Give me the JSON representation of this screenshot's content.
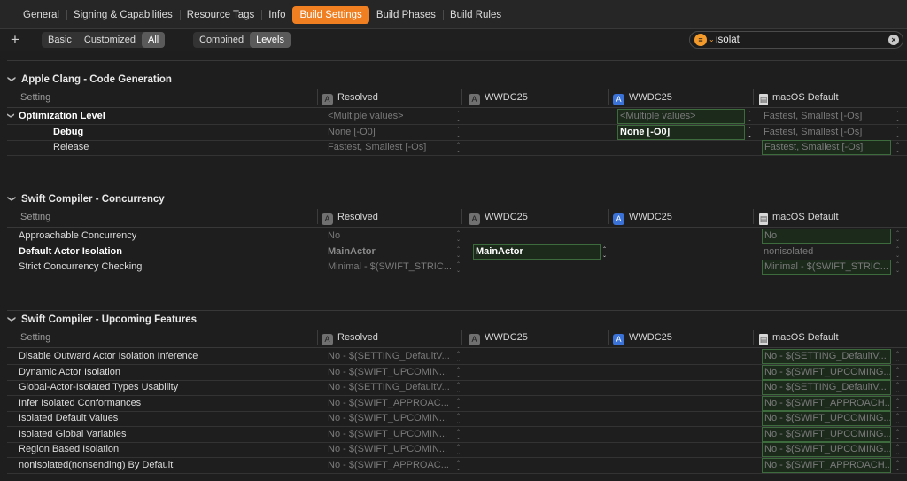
{
  "tabs": [
    {
      "label": "General",
      "active": false
    },
    {
      "label": "Signing & Capabilities",
      "active": false
    },
    {
      "label": "Resource Tags",
      "active": false
    },
    {
      "label": "Info",
      "active": false
    },
    {
      "label": "Build Settings",
      "active": true
    },
    {
      "label": "Build Phases",
      "active": false
    },
    {
      "label": "Build Rules",
      "active": false
    }
  ],
  "toolbar": {
    "add": "+",
    "scope": [
      "Basic",
      "Customized",
      "All"
    ],
    "scope_selected": "All",
    "view": [
      "Combined",
      "Levels"
    ],
    "view_selected": "Levels",
    "search_value": "isolat",
    "filter_icon": "line-3-horizontal-decrease-circle-icon",
    "clear_icon": "xmark-circle-icon"
  },
  "columns": {
    "setting": "Setting",
    "resolved": "Resolved",
    "target": "WWDC25",
    "project": "WWDC25",
    "default": "macOS Default"
  },
  "sections": [
    {
      "title": "Apple Clang - Code Generation",
      "rows": [
        {
          "name": "Optimization Level",
          "bold": true,
          "indent": false,
          "resolved": "<Multiple values>",
          "target": "",
          "project": "<Multiple values>",
          "project_hi": true,
          "project_bold": false,
          "default": "Fastest, Smallest [-Os]",
          "default_hi": false
        },
        {
          "name": "Debug",
          "bold": true,
          "indent": true,
          "resolved": "None [-O0]",
          "target": "",
          "project": "None [-O0]",
          "project_hi": true,
          "project_bold": true,
          "default": "Fastest, Smallest [-Os]",
          "default_hi": false
        },
        {
          "name": "Release",
          "bold": false,
          "indent": true,
          "resolved": "Fastest, Smallest [-Os]",
          "target": "",
          "project": "",
          "project_hi": false,
          "project_bold": false,
          "default": "Fastest, Smallest [-Os]",
          "default_hi": true
        }
      ]
    },
    {
      "title": "Swift Compiler - Concurrency",
      "rows": [
        {
          "name": "Approachable Concurrency",
          "bold": false,
          "indent": false,
          "resolved": "No",
          "target": "",
          "project": "",
          "default": "No",
          "default_hi": true
        },
        {
          "name": "Default Actor Isolation",
          "bold": true,
          "indent": false,
          "resolved": "MainActor",
          "target": "MainActor",
          "target_hi": true,
          "project": "",
          "default": "nonisolated",
          "default_hi": false
        },
        {
          "name": "Strict Concurrency Checking",
          "bold": false,
          "indent": false,
          "resolved": "Minimal  -  $(SWIFT_STRIC...",
          "target": "",
          "project": "",
          "default": "Minimal  -  $(SWIFT_STRIC...",
          "default_hi": true
        }
      ]
    },
    {
      "title": "Swift Compiler - Upcoming Features",
      "rows": [
        {
          "name": "Disable Outward Actor Isolation Inference",
          "bold": false,
          "indent": false,
          "resolved": "No  -  $(SETTING_DefaultV...",
          "target": "",
          "project": "",
          "default": "No  -  $(SETTING_DefaultV...",
          "default_hi": true
        },
        {
          "name": "Dynamic Actor Isolation",
          "bold": false,
          "indent": false,
          "resolved": "No  -  $(SWIFT_UPCOMIN...",
          "target": "",
          "project": "",
          "default": "No  -  $(SWIFT_UPCOMING...",
          "default_hi": true
        },
        {
          "name": "Global-Actor-Isolated Types Usability",
          "bold": false,
          "indent": false,
          "resolved": "No  -  $(SETTING_DefaultV...",
          "target": "",
          "project": "",
          "default": "No  -  $(SETTING_DefaultV...",
          "default_hi": true
        },
        {
          "name": "Infer Isolated Conformances",
          "bold": false,
          "indent": false,
          "resolved": "No  -  $(SWIFT_APPROAC...",
          "target": "",
          "project": "",
          "default": "No  -  $(SWIFT_APPROACH...",
          "default_hi": true
        },
        {
          "name": "Isolated Default Values",
          "bold": false,
          "indent": false,
          "resolved": "No  -  $(SWIFT_UPCOMIN...",
          "target": "",
          "project": "",
          "default": "No  -  $(SWIFT_UPCOMING...",
          "default_hi": true
        },
        {
          "name": "Isolated Global Variables",
          "bold": false,
          "indent": false,
          "resolved": "No  -  $(SWIFT_UPCOMIN...",
          "target": "",
          "project": "",
          "default": "No  -  $(SWIFT_UPCOMING...",
          "default_hi": true
        },
        {
          "name": "Region Based Isolation",
          "bold": false,
          "indent": false,
          "resolved": "No  -  $(SWIFT_UPCOMIN...",
          "target": "",
          "project": "",
          "default": "No  -  $(SWIFT_UPCOMING...",
          "default_hi": true
        },
        {
          "name": "nonisolated(nonsending) By Default",
          "bold": false,
          "indent": false,
          "resolved": "No  -  $(SWIFT_APPROAC...",
          "target": "",
          "project": "",
          "default": "No  -  $(SWIFT_APPROACH...",
          "default_hi": true
        }
      ]
    }
  ]
}
